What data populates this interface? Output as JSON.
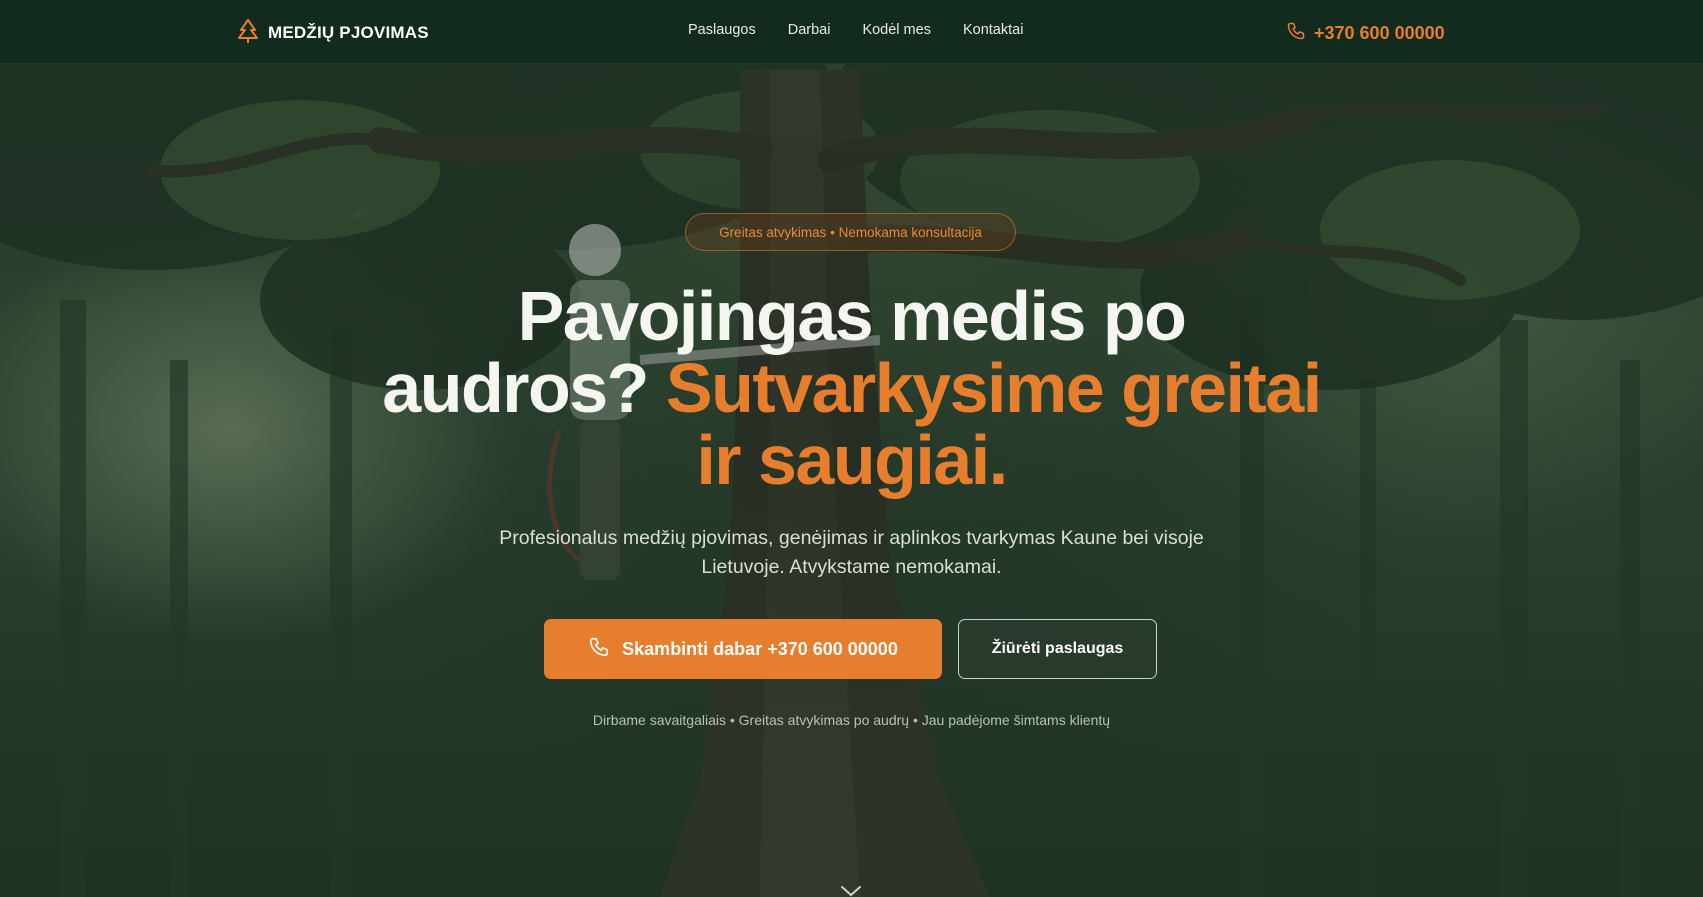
{
  "brand": {
    "name": "MEDŽIŲ PJOVIMAS",
    "icon": "tree-icon",
    "accent": "#e67e2e"
  },
  "nav": {
    "links": [
      "Paslaugos",
      "Darbai",
      "Kodėl mes",
      "Kontaktai"
    ],
    "phone": "+370 600 00000",
    "phone_icon": "phone-icon"
  },
  "hero": {
    "badge": "Greitas atvykimas • Nemokama konsultacija",
    "headline_white": "Pavojingas medis po audros?",
    "headline_accent": "Sutvarkysime greitai ir saugiai.",
    "subtitle": "Profesionalus medžių pjovimas, genėjimas ir aplinkos tvarkymas Kaune bei visoje Lietuvoje. Atvykstame nemokamai.",
    "primary_button": "Skambinti dabar +370 600 00000",
    "secondary_button": "Žiūrėti paslaugas",
    "trust_line": "Dirbame savaitgaliais • Greitas atvykimas po audrų • Jau padėjome šimtams klientų",
    "scroll_icon": "chevron-down-icon"
  },
  "colors": {
    "nav_bg": "#132a1f",
    "accent": "#e67e2e",
    "text": "#f5f5f2"
  }
}
